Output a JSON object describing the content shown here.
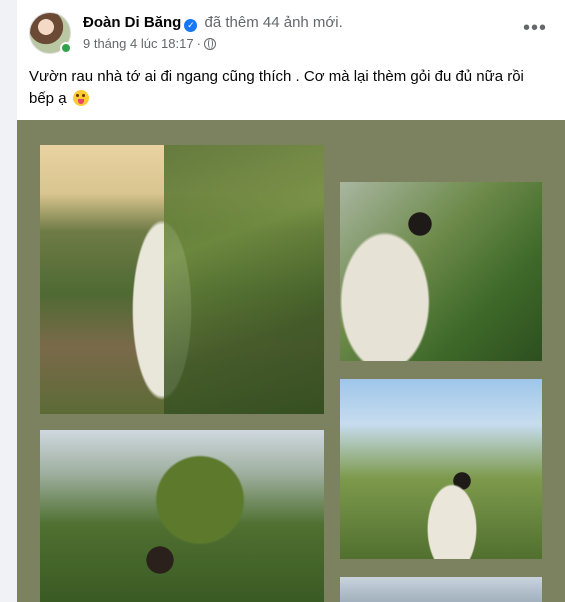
{
  "post": {
    "author": "Đoàn Di Băng",
    "verified_mark": "✓",
    "action": "đã thêm 44 ảnh mới.",
    "timestamp": "9 tháng 4 lúc 18:17",
    "separator": "·",
    "privacy_icon": "globe-icon",
    "more_label": "•••",
    "text": "Vườn rau nhà tớ ai đi ngang cũng thích . Cơ mà lại thèm gỏi đu đủ nữa rồi bếp ạ",
    "emoji_icon": "squinting-tongue-face-icon",
    "photos_count": 44
  },
  "colors": {
    "gallery_background": "#7c8260",
    "verified_blue": "#1877f2",
    "online_green": "#31a24c",
    "secondary_text": "#65676b"
  }
}
